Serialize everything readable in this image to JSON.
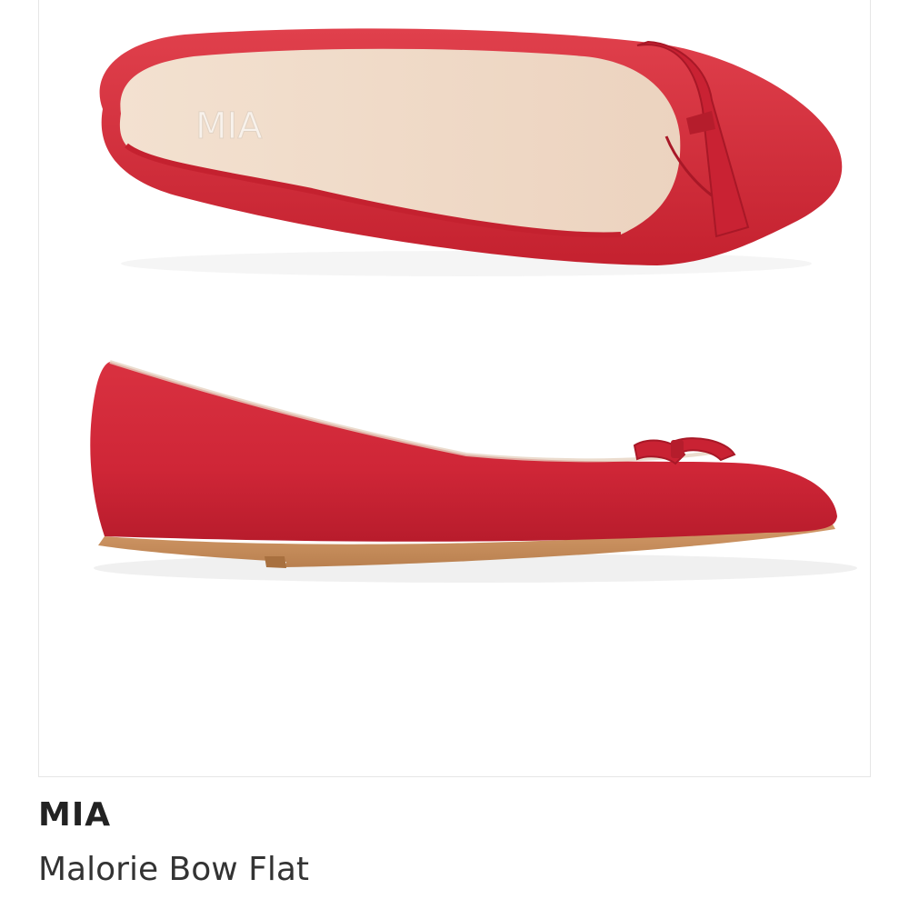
{
  "product": {
    "brand": "MIA",
    "name": "Malorie Bow Flat",
    "insole_logo": "MIA",
    "shoe_color": "#d0303f"
  }
}
